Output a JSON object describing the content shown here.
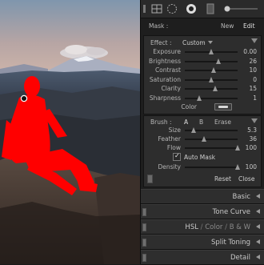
{
  "mask": {
    "label": "Mask :",
    "new_label": "New",
    "edit_label": "Edit"
  },
  "effect": {
    "label": "Effect :",
    "preset": "Custom",
    "sliders": [
      {
        "key": "exposure",
        "label": "Exposure",
        "value": "0.00",
        "pos": 0.5
      },
      {
        "key": "brightness",
        "label": "Brightness",
        "value": "26",
        "pos": 0.63
      },
      {
        "key": "contrast",
        "label": "Contrast",
        "value": "10",
        "pos": 0.55
      },
      {
        "key": "saturation",
        "label": "Saturation",
        "value": "0",
        "pos": 0.5
      },
      {
        "key": "clarity",
        "label": "Clarity",
        "value": "15",
        "pos": 0.58
      },
      {
        "key": "sharpness",
        "label": "Sharpness",
        "value": "1",
        "pos": 0.28
      }
    ],
    "color_label": "Color"
  },
  "brush": {
    "label": "Brush :",
    "tab_a": "A",
    "tab_b": "B",
    "erase": "Erase",
    "sliders": [
      {
        "key": "size",
        "label": "Size",
        "value": "5.3",
        "pos": 0.17
      },
      {
        "key": "feather",
        "label": "Feather",
        "value": "36",
        "pos": 0.36
      },
      {
        "key": "flow",
        "label": "Flow",
        "value": "100",
        "pos": 1.0
      }
    ],
    "auto_mask_label": "Auto Mask",
    "auto_mask_checked": true,
    "density": {
      "label": "Density",
      "value": "100",
      "pos": 1.0
    },
    "reset_label": "Reset",
    "close_label": "Close"
  },
  "sections": {
    "basic": "Basic",
    "tone_curve": "Tone Curve",
    "hsl": "HSL",
    "sep1": "/",
    "color": "Color",
    "sep2": "/",
    "bw": "B & W",
    "split_toning": "Split Toning",
    "detail": "Detail"
  },
  "colors": {
    "mask_overlay": "#ff0000",
    "panel_bg": "#2d2d2d",
    "header_bg": "#2e2e2e"
  }
}
